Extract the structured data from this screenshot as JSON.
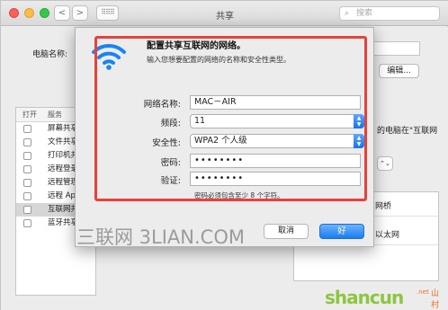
{
  "window": {
    "title": "共享",
    "search_placeholder": "搜索",
    "nav_back": "<",
    "nav_forward": ">",
    "grid_glyph": "⠿⠿⠿"
  },
  "background": {
    "computer_name_label": "电脑名称:",
    "edit_button": "编辑...",
    "list_headers": {
      "on": "打开",
      "service": "服务"
    },
    "services": [
      "屏幕共享",
      "文件共享",
      "打印机共享",
      "远程登录",
      "远程管理",
      "远程 Apple",
      "互联网共享",
      "蓝牙共享"
    ],
    "selected_service_index": 6,
    "right_text": "的电脑在\"互联网",
    "right_items": [
      "网桥",
      "以太网"
    ]
  },
  "sheet": {
    "title": "配置共享互联网的网络。",
    "subtitle": "输入您想要配置的网络的名称和安全性类型。",
    "network_name_label": "网络名称:",
    "network_name_value": "MAC－AIR",
    "channel_label": "频段:",
    "channel_value": "11",
    "security_label": "安全性:",
    "security_value": "WPA2 个人级",
    "password_label": "密码:",
    "password_value": "••••••••",
    "verify_label": "验证:",
    "verify_value": "••••••••",
    "hint": "密码必须包含至少 8 个字符。",
    "cancel_label": "取消",
    "ok_label": "好"
  },
  "watermark": "三联网 3LIAN.COM",
  "logo": {
    "main": "shancun",
    "dot": ".net",
    "cn": "山村网"
  },
  "colors": {
    "accent": "#1b7cf1",
    "highlight_box": "#e8413a",
    "wifi": "#1a84f0",
    "logo_green": "#8cc63f",
    "logo_orange": "#f26b2a"
  },
  "icons": [
    "wifi-icon",
    "search-icon",
    "chevron-updown-icon"
  ]
}
